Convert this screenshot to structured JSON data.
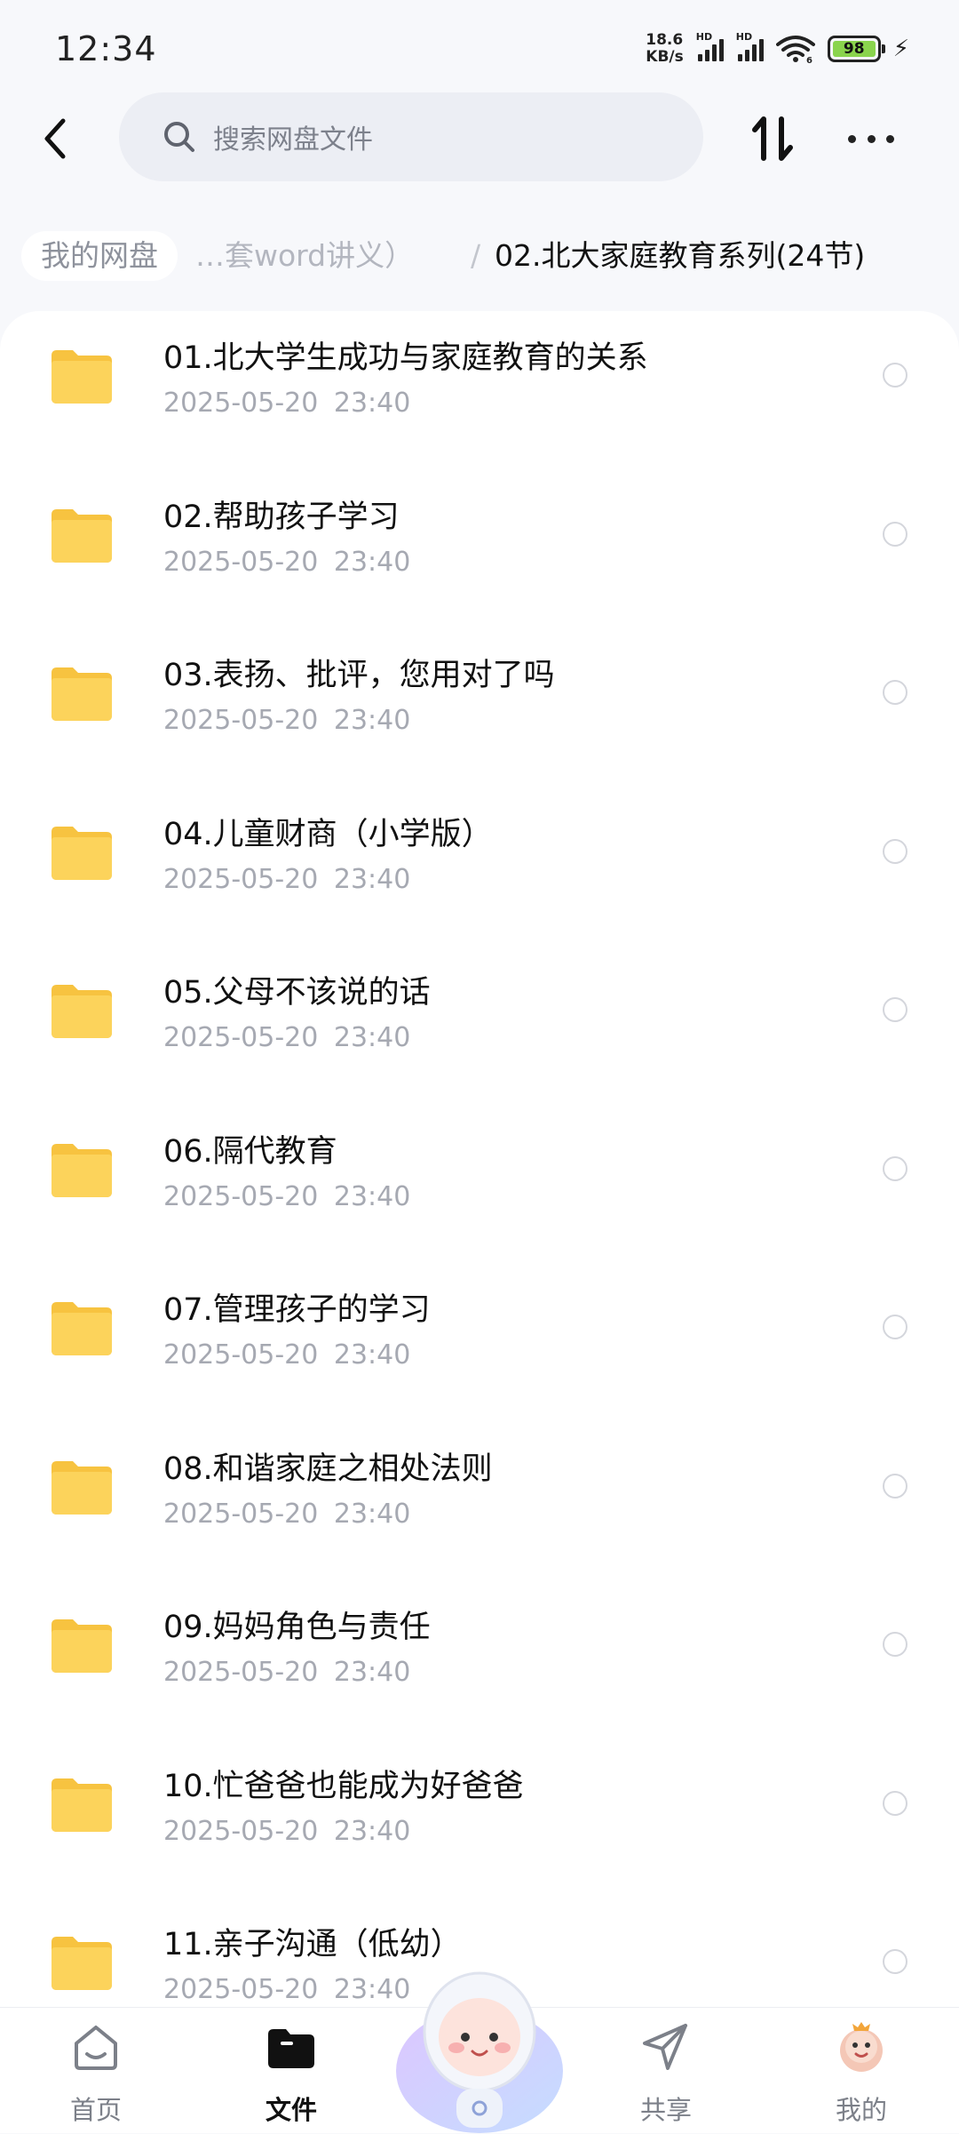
{
  "status_bar": {
    "time": "12:34",
    "net_speed_value": "18.6",
    "net_speed_unit": "KB/s",
    "sim1_label": "HD",
    "sim2_label": "HD",
    "wifi_label": "6",
    "battery_level": "98"
  },
  "header": {
    "back_icon": "back-arrow-icon",
    "search_placeholder": "搜索网盘文件",
    "sort_icon": "sort-icon",
    "more_icon": "more-icon"
  },
  "breadcrumb": {
    "root": "我的网盘",
    "middle": "…套word讲义）",
    "separator": "/",
    "current": "02.北大家庭教育系列(24节)"
  },
  "files": [
    {
      "name": "01.北大学生成功与家庭教育的关系",
      "date": "2025-05-20  23:40"
    },
    {
      "name": "02.帮助孩子学习",
      "date": "2025-05-20  23:40"
    },
    {
      "name": "03.表扬、批评，您用对了吗",
      "date": "2025-05-20  23:40"
    },
    {
      "name": "04.儿童财商（小学版）",
      "date": "2025-05-20  23:40"
    },
    {
      "name": "05.父母不该说的话",
      "date": "2025-05-20  23:40"
    },
    {
      "name": "06.隔代教育",
      "date": "2025-05-20  23:40"
    },
    {
      "name": "07.管理孩子的学习",
      "date": "2025-05-20  23:40"
    },
    {
      "name": "08.和谐家庭之相处法则",
      "date": "2025-05-20  23:40"
    },
    {
      "name": "09.妈妈角色与责任",
      "date": "2025-05-20  23:40"
    },
    {
      "name": "10.忙爸爸也能成为好爸爸",
      "date": "2025-05-20  23:40"
    },
    {
      "name": "11.亲子沟通（低幼）",
      "date": "2025-05-20  23:40"
    }
  ],
  "bottom_nav": [
    {
      "label": "首页",
      "icon": "home-icon"
    },
    {
      "label": "文件",
      "icon": "folder-icon",
      "active": true
    },
    {
      "label": "共享",
      "icon": "send-icon"
    },
    {
      "label": "我的",
      "icon": "avatar-icon"
    }
  ],
  "colors": {
    "folder": "#fcd35b",
    "folder_tab": "#f7c340",
    "battery": "#8ad44d",
    "accent": "#111111"
  }
}
